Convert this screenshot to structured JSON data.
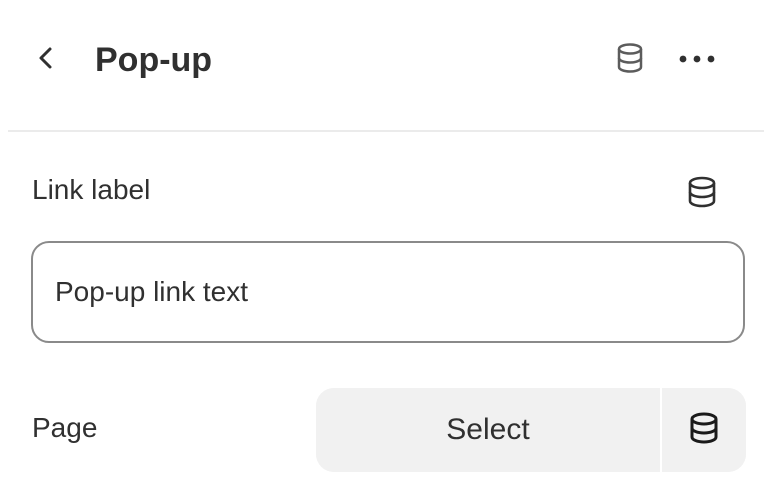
{
  "header": {
    "title": "Pop-up",
    "back_icon": "chevron-left-icon",
    "db_icon": "database-icon",
    "more_icon": "more-horizontal-icon"
  },
  "link_label": {
    "label": "Link label",
    "icon": "database-icon",
    "value": "Pop-up link text"
  },
  "page": {
    "label": "Page",
    "select_label": "Select",
    "icon": "database-icon"
  }
}
